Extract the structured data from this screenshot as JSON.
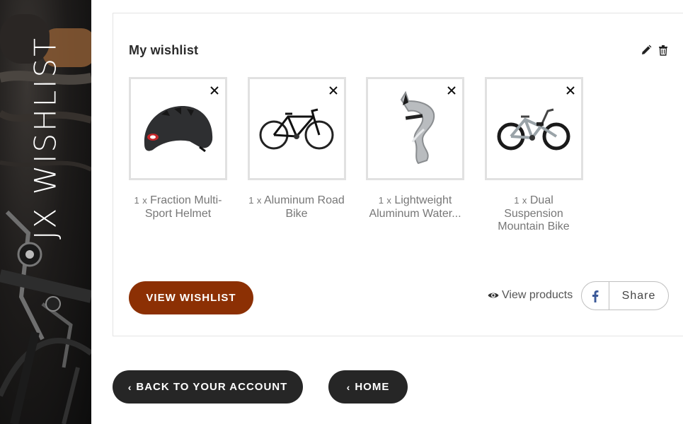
{
  "sidebar": {
    "title": "JX WISHLIST"
  },
  "wishlist": {
    "title": "My wishlist",
    "actions": {
      "edit_icon": "pencil-icon",
      "delete_icon": "trash-icon"
    },
    "products": [
      {
        "qty": "1",
        "qty_sep": "x",
        "name": "Fraction Multi-Sport Helmet",
        "image": "helmet"
      },
      {
        "qty": "1",
        "qty_sep": "x",
        "name": "Aluminum Road Bike",
        "image": "road-bike"
      },
      {
        "qty": "1",
        "qty_sep": "x",
        "name": "Lightweight Aluminum Water...",
        "image": "bottle-cage"
      },
      {
        "qty": "1",
        "qty_sep": "x",
        "name": "Dual Suspension Mountain Bike",
        "image": "mountain-bike"
      }
    ],
    "view_wishlist_label": "VIEW WISHLIST",
    "view_products_label": "View products",
    "share_label": "Share"
  },
  "nav": {
    "back_label": "BACK TO YOUR ACCOUNT",
    "home_label": "HOME",
    "chevron": "‹"
  },
  "colors": {
    "accent": "#8c3004",
    "dark_button": "#262626",
    "facebook": "#3b5998"
  }
}
